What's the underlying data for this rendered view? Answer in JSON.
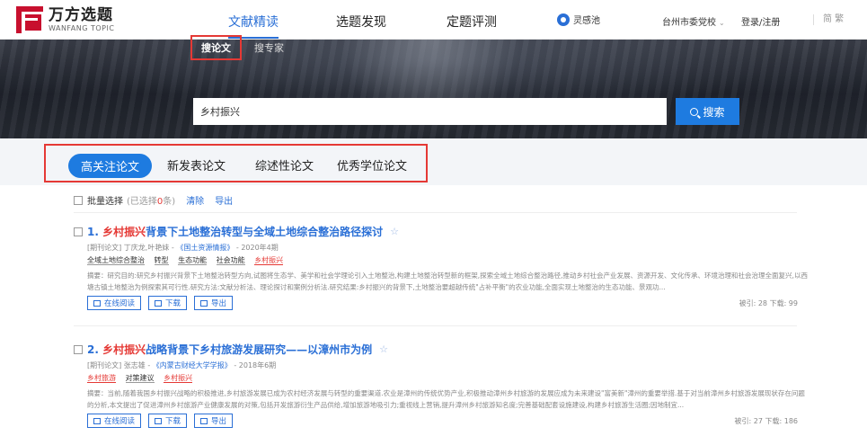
{
  "brand": {
    "cn": "万方选题",
    "en": "WANFANG TOPIC"
  },
  "nav": [
    {
      "label": "文献精读",
      "active": true
    },
    {
      "label": "选题发现",
      "active": false
    },
    {
      "label": "定题评测",
      "active": false
    }
  ],
  "linggan": "灵感池",
  "org": "台州市委党校",
  "login": "登录/注册",
  "lang": "简 繁",
  "search": {
    "tabs": [
      "搜论文",
      "搜专家"
    ],
    "value": "乡村振兴",
    "button": "搜索"
  },
  "categories": [
    {
      "label": "高关注论文",
      "active": true
    },
    {
      "label": "新发表论文",
      "active": false
    },
    {
      "label": "综述性论文",
      "active": false
    },
    {
      "label": "优秀学位论文",
      "active": false
    }
  ],
  "bulk": {
    "label": "批量选择",
    "selected_prefix": "(已选择",
    "selected_count": "0",
    "selected_suffix": "条)",
    "clear": "清除",
    "export": "导出"
  },
  "results": [
    {
      "num": "1.",
      "title_hl": "乡村振兴",
      "title_rest": "背景下土地整治转型与全域土地综合整治路径探讨",
      "meta_type": "[期刊论文]",
      "authors": "丁庆龙,叶艳妹",
      "source": "《国土资源情报》",
      "issue": "2020年4期",
      "keywords": [
        {
          "text": "全域土地综合整治",
          "hl": false
        },
        {
          "text": "转型",
          "hl": false
        },
        {
          "text": "生态功能",
          "hl": false
        },
        {
          "text": "社会功能",
          "hl": false
        },
        {
          "text": "乡村振兴",
          "hl": true
        }
      ],
      "abstract": "摘要：研究目的:研究乡村振兴背景下土地整治转型方向,试图将生态学、美学和社会学理论引入土地整治,构建土地整治转型新的框架,探索全域土地综合整治路径,推动乡村社会产业发展、资源开发、文化传承、环境治理和社会治理全面复兴,以西塘古镇土地整治为例探索其可行性.研究方法:文献分析法、理论探讨和案例分析法.研究结果:乡村振兴的背景下,土地整治要超越传统\"占补平衡\"的农业功能,全面实现土地整治的生态功能、景观功...",
      "actions": [
        "在线阅读",
        "下载",
        "导出"
      ],
      "stats": "被引: 28  下载: 99"
    },
    {
      "num": "2.",
      "title_hl": "乡村振兴",
      "title_rest": "战略背景下乡村旅游发展研究——以漳州市为例",
      "meta_type": "[期刊论文]",
      "authors": "张志雄",
      "source": "《内蒙古财经大学学报》",
      "issue": "2018年6期",
      "keywords": [
        {
          "text": "乡村旅游",
          "hl": true
        },
        {
          "text": "对策建议",
          "hl": false
        },
        {
          "text": "乡村振兴",
          "hl": true
        }
      ],
      "abstract": "摘要：当前,随着我国乡村振兴战略的积极推进,乡村旅游发展已成为农村经济发展与转型的重要渠道.农业是漳州的传统优势产业,积极推动漳州乡村旅游的发展应成为未来建设\"富美新\"漳州的重要举措.基于对当前漳州乡村旅游发展现状存在问题的分析,本文提出了促进漳州乡村旅游产业健康发展的对策,包括开发旅游衍生产品供给,增加旅游地吸引力;重视线上营销,提升漳州乡村旅游知名度;完善基础配套设施建设,构建乡村旅游生活圈;因地制宜...",
      "actions": [
        "在线阅读",
        "下载",
        "导出"
      ],
      "stats": "被引: 27  下载: 186"
    }
  ],
  "colors": {
    "accent": "#1e7be0",
    "highlight": "#e53935",
    "brand": "#c8102e"
  }
}
